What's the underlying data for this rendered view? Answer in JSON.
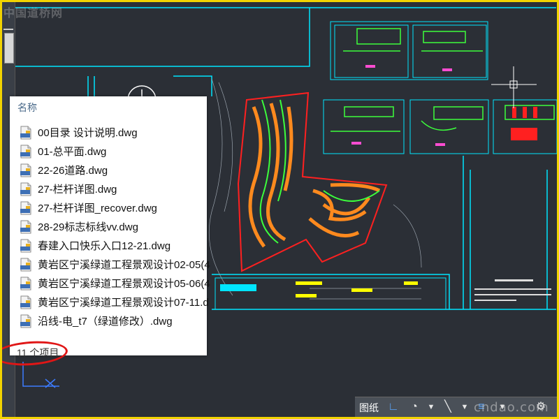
{
  "watermark_top": "中国道桥网",
  "watermark_bottom": "cndao.com",
  "file_panel": {
    "column_header": "名称",
    "files": [
      "00目录 设计说明.dwg",
      "01-总平面.dwg",
      "22-26道路.dwg",
      "27-栏杆详图.dwg",
      "27-栏杆详图_recover.dwg",
      "28-29标志标线vv.dwg",
      "春建入口快乐入口12-21.dwg",
      "黄岩区宁溪绿道工程景观设计02-05(4",
      "黄岩区宁溪绿道工程景观设计05-06(4",
      "黄岩区宁溪绿道工程景观设计07-11.d",
      "沿线-电_t7（绿道修改）.dwg"
    ],
    "status": "11 个项目",
    "icon": "dwg-file-icon"
  },
  "statusbar": {
    "tab_label": "图纸",
    "icons": [
      "snap-angle-icon",
      "polar-tracking-icon",
      "chevron-down-icon",
      "ortho-icon",
      "chevron-down-icon",
      "lineweight-icon",
      "chevron-down-icon",
      "settings-icon"
    ]
  },
  "colors": {
    "frame_border": "#f2d300",
    "cad_background": "#2b2f36",
    "cyan": "#00e5ff",
    "red": "#ff2020",
    "orange": "#ff8a1e",
    "green": "#3cff3c",
    "highlight": "#e01616"
  }
}
